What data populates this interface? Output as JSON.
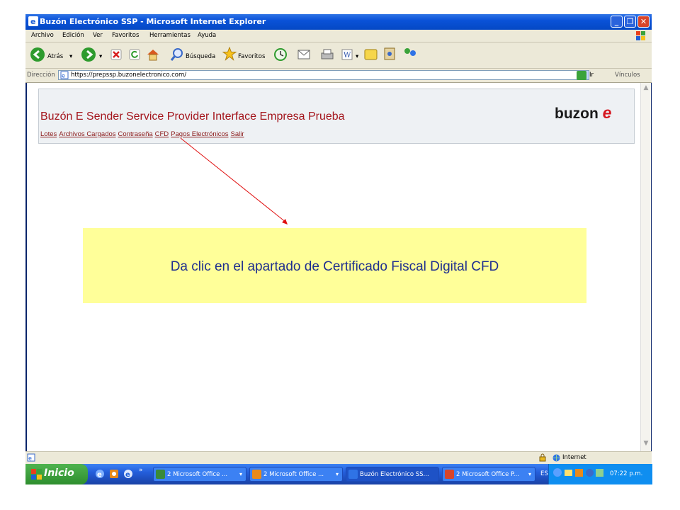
{
  "window": {
    "title": "Buzón Electrónico SSP - Microsoft Internet Explorer"
  },
  "menu": [
    "Archivo",
    "Edición",
    "Ver",
    "Favoritos",
    "Herramientas",
    "Ayuda"
  ],
  "toolbar": {
    "back_label": "Atrás",
    "search_label": "Búsqueda",
    "favorites_label": "Favoritos"
  },
  "address": {
    "label": "Dirección",
    "url": "https://prepssp.buzonelectronico.com/",
    "go_label": "Ir",
    "links_label": "Vínculos"
  },
  "page": {
    "title": "Buzón E Sender Service Provider Interface Empresa Prueba",
    "logo_text": "buzon",
    "logo_mark": "e",
    "nav": [
      "Lotes",
      "Archivos Cargados",
      "Contraseña",
      "CFD",
      "Pagos Electrónicos",
      "Salir"
    ]
  },
  "callout": {
    "text": "Da clic en el apartado de Certificado Fiscal Digital CFD"
  },
  "status": {
    "zone": "Internet"
  },
  "taskbar": {
    "start_label": "Inicio",
    "tasks": [
      {
        "label": "2 Microsoft Office ...",
        "icon_color": "#3a8a3a"
      },
      {
        "label": "2 Microsoft Office ...",
        "icon_color": "#e88a1a"
      },
      {
        "label": "Buzón Electrónico SS...",
        "icon_color": "#2f73e6"
      },
      {
        "label": "2 Microsoft Office P...",
        "icon_color": "#d8452a"
      }
    ],
    "lang": "ES",
    "clock": "07:22 p.m."
  },
  "colors": {
    "title_red": "#a4161d",
    "callout_bg": "#ffff99",
    "callout_text": "#1f2f8f",
    "arrow": "#e01010"
  }
}
